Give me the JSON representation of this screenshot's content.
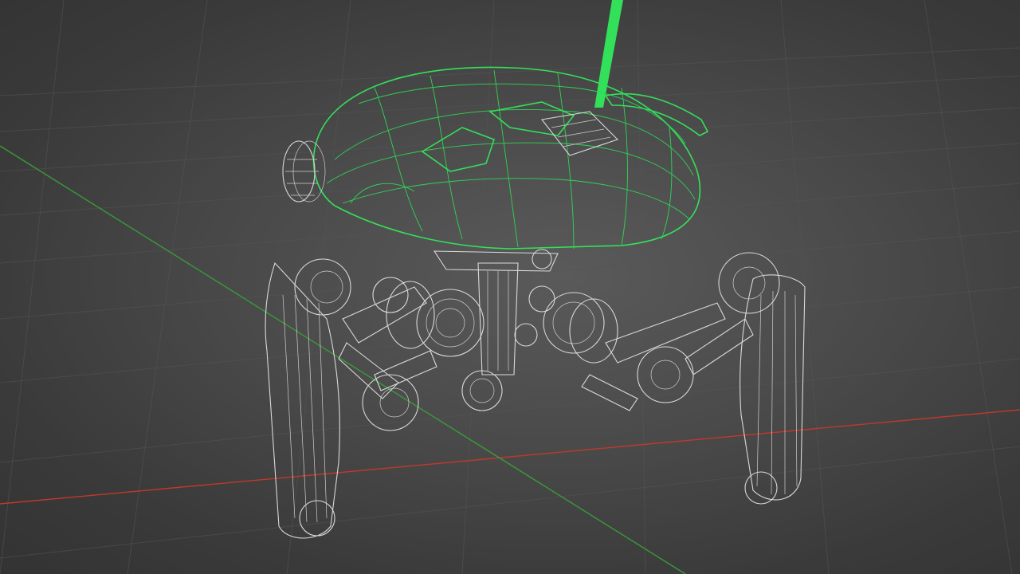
{
  "viewport": {
    "mode": "wireframe",
    "background": "#4a4a4a",
    "axis_colors": {
      "x": "#c0392b",
      "y": "#3a9a3a"
    },
    "selection_color": "#33e05a",
    "wire_color": "#d9d9d9"
  },
  "scene": {
    "object": "spider-robot",
    "selected_part": "dome-body",
    "legs": 4
  }
}
